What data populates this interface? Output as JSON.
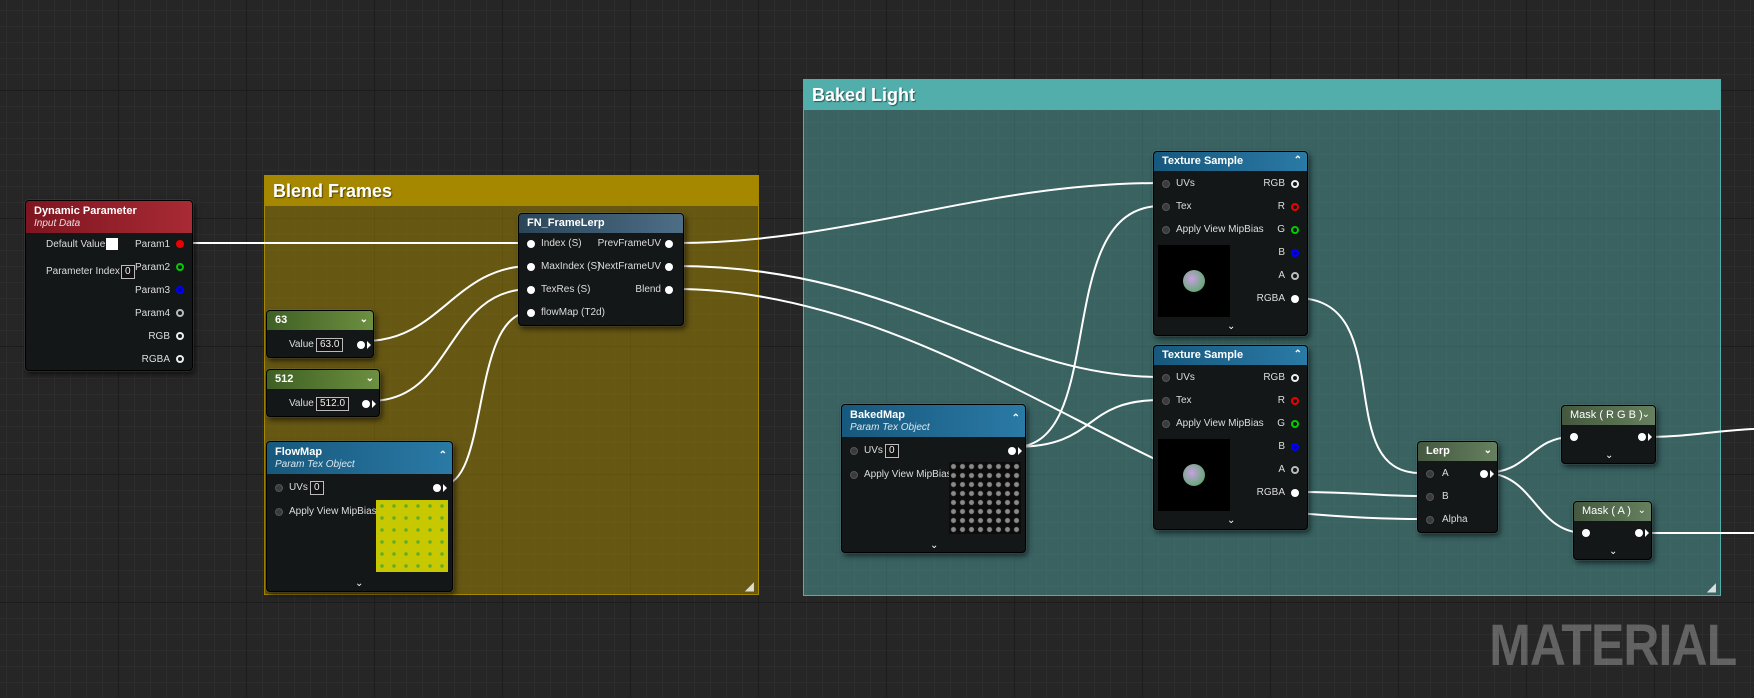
{
  "comments": {
    "blend_frames": {
      "title": "Blend Frames",
      "color": "#a58700"
    },
    "baked_light": {
      "title": "Baked Light",
      "color": "#52aeaa"
    }
  },
  "dynamic_parameter": {
    "title": "Dynamic Parameter",
    "subtitle": "Input Data",
    "default_value_label": "Default Value",
    "parameter_index_label": "Parameter Index",
    "parameter_index_value": "0",
    "outputs": [
      "Param1",
      "Param2",
      "Param3",
      "Param4",
      "RGB",
      "RGBA"
    ]
  },
  "fn_framelerp": {
    "title": "FN_FrameLerp",
    "inputs": [
      "Index (S)",
      "MaxIndex (S)",
      "TexRes (S)",
      "flowMap (T2d)"
    ],
    "outputs": [
      "PrevFrameUV",
      "NextFrameUV",
      "Blend"
    ]
  },
  "const_63": {
    "title": "63",
    "value_label": "Value",
    "value": "63.0"
  },
  "const_512": {
    "title": "512",
    "value_label": "Value",
    "value": "512.0"
  },
  "flowmap": {
    "title": "FlowMap",
    "subtitle": "Param Tex Object",
    "uvs_label": "UVs",
    "uvs_value": "0",
    "mipbias_label": "Apply View MipBias"
  },
  "bakedmap": {
    "title": "BakedMap",
    "subtitle": "Param Tex Object",
    "uvs_label": "UVs",
    "uvs_value": "0",
    "mipbias_label": "Apply View MipBias"
  },
  "texture_sample_1": {
    "title": "Texture Sample",
    "inputs": [
      "UVs",
      "Tex",
      "Apply View MipBias"
    ],
    "outputs": [
      "RGB",
      "R",
      "G",
      "B",
      "A",
      "RGBA"
    ]
  },
  "texture_sample_2": {
    "title": "Texture Sample",
    "inputs": [
      "UVs",
      "Tex",
      "Apply View MipBias"
    ],
    "outputs": [
      "RGB",
      "R",
      "G",
      "B",
      "A",
      "RGBA"
    ]
  },
  "lerp": {
    "title": "Lerp",
    "inputs": [
      "A",
      "B",
      "Alpha"
    ]
  },
  "mask_rgb": {
    "title": "Mask ( R G B )"
  },
  "mask_a": {
    "title": "Mask ( A )"
  },
  "watermark": "MATERIAL",
  "colors": {
    "dynamic_param_header": "#8a1a22",
    "function_header": "#2d4c63",
    "constant_header": "#4b6a2a",
    "texture_header": "#1d5f85",
    "lerp_header": "#4a5f45",
    "wire": "#ffffff"
  }
}
